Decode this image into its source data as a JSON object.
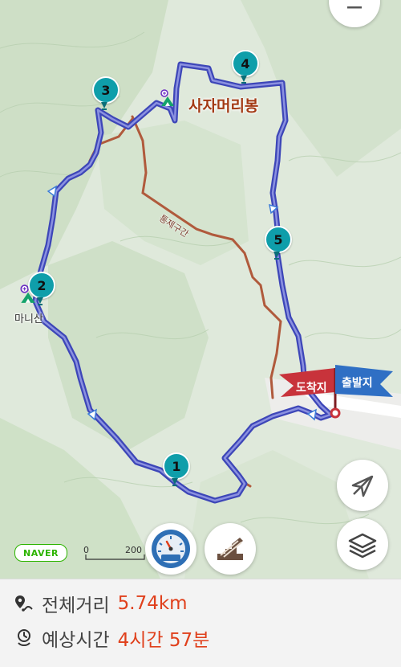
{
  "map": {
    "peak_name": "사자머리봉",
    "secondary_peak_name": "마니산",
    "trail_label": "통제구간",
    "flag_end_label": "도착지",
    "flag_start_label": "출발지",
    "waypoints": [
      "1",
      "2",
      "3",
      "4",
      "5"
    ],
    "brand": "NAVER",
    "scale_start": "0",
    "scale_end": "200"
  },
  "summary": {
    "distance_label": "전체거리",
    "distance_value": "5.74km",
    "time_label": "예상시간",
    "time_value": "4시간 57분"
  },
  "colors": {
    "route": "#3d46b8",
    "route_fill": "#8b91e0",
    "waypoint": "#0f9eaa",
    "trail": "#b05a3c",
    "flag_end": "#c8333b",
    "flag_start": "#2f6fc4",
    "accent_value": "#e0401c",
    "brand": "#2db400"
  },
  "icons": {
    "top_button": "menu-icon",
    "compass": "compass-icon",
    "route_view": "route-profile-icon",
    "location": "location-off-icon",
    "layers": "layers-icon",
    "distance": "route-pin-icon",
    "time": "time-pin-icon",
    "peak": "mountain-peak-icon"
  }
}
